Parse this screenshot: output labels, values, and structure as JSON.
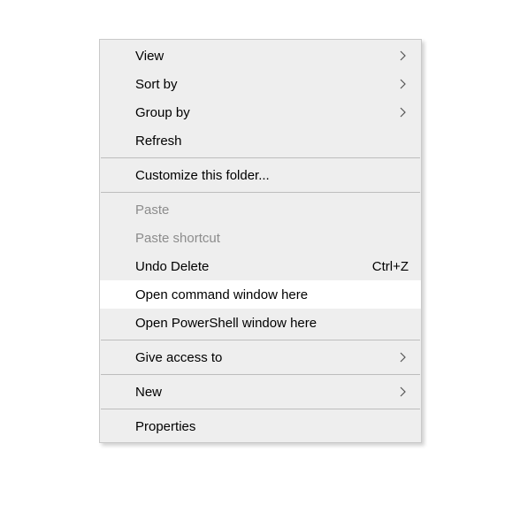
{
  "menu": {
    "view": {
      "label": "View"
    },
    "sort_by": {
      "label": "Sort by"
    },
    "group_by": {
      "label": "Group by"
    },
    "refresh": {
      "label": "Refresh"
    },
    "customize": {
      "label": "Customize this folder..."
    },
    "paste": {
      "label": "Paste"
    },
    "paste_shortcut": {
      "label": "Paste shortcut"
    },
    "undo_delete": {
      "label": "Undo Delete",
      "shortcut": "Ctrl+Z"
    },
    "open_cmd": {
      "label": "Open command window here"
    },
    "open_powershell": {
      "label": "Open PowerShell window here"
    },
    "give_access": {
      "label": "Give access to"
    },
    "new": {
      "label": "New"
    },
    "properties": {
      "label": "Properties"
    }
  }
}
